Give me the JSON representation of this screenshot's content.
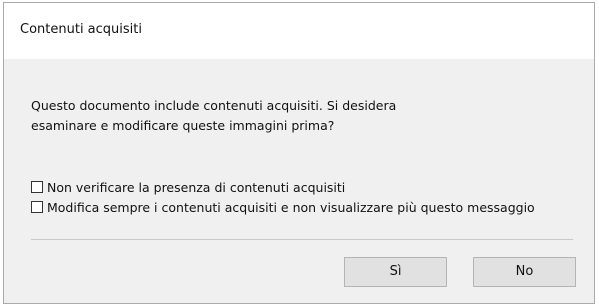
{
  "dialog": {
    "title": "Contenuti acquisiti",
    "message_line1": "Questo documento include contenuti acquisiti. Si desidera",
    "message_line2": "esaminare e modificare queste immagini prima?",
    "checkboxes": [
      {
        "label": "Non verificare la presenza di contenuti acquisiti",
        "checked": false
      },
      {
        "label": "Modifica sempre i contenuti acquisiti e non visualizzare più questo messaggio",
        "checked": false
      }
    ],
    "buttons": {
      "yes_label": "Sì",
      "no_label": "No"
    }
  },
  "colors": {
    "dialog_background": "#f0f0f0",
    "titlebar_background": "#ffffff",
    "button_background": "#e1e1e1",
    "button_border": "#b4b4b4",
    "divider": "#c8c8c8"
  }
}
